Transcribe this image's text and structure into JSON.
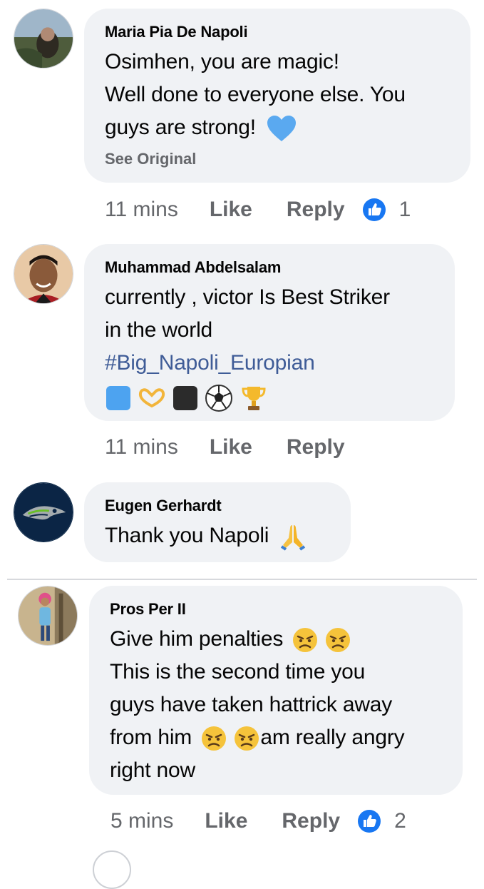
{
  "comments": [
    {
      "author": "Maria Pia De Napoli",
      "lines": [
        "Osimhen, you are magic!",
        "Well done to everyone else. You",
        "guys are strong!"
      ],
      "emoji": [
        "blue-heart"
      ],
      "see_original": "See Original",
      "time": "11 mins",
      "like": "Like",
      "reply": "Reply",
      "reaction_count": "1"
    },
    {
      "author": "Muhammad Abdelsalam",
      "lines": [
        "currently , victor Is Best Striker",
        "in the world"
      ],
      "hashtag": "#Big_Napoli_Europian",
      "emoji": [
        "blue-square",
        "heart-hands",
        "black-square",
        "soccer-ball",
        "trophy"
      ],
      "time": "11 mins",
      "like": "Like",
      "reply": "Reply"
    },
    {
      "author": "Eugen Gerhardt",
      "lines": [
        "Thank you Napoli"
      ],
      "emoji": [
        "folded-hands"
      ]
    },
    {
      "author": "Pros Per II",
      "lines": [
        "Give him penalties",
        "This is the second time you",
        "guys have taken hattrick away",
        "from him",
        "am really angry",
        "right now"
      ],
      "emoji": [
        "angry-face",
        "angry-face",
        "angry-face",
        "angry-face"
      ],
      "time": "5 mins",
      "like": "Like",
      "reply": "Reply",
      "reaction_count": "2"
    }
  ],
  "colors": {
    "bubble": "#f0f2f5",
    "meta_text": "#65676b",
    "hashtag": "#3f5c97",
    "like_blue": "#1877f2"
  }
}
